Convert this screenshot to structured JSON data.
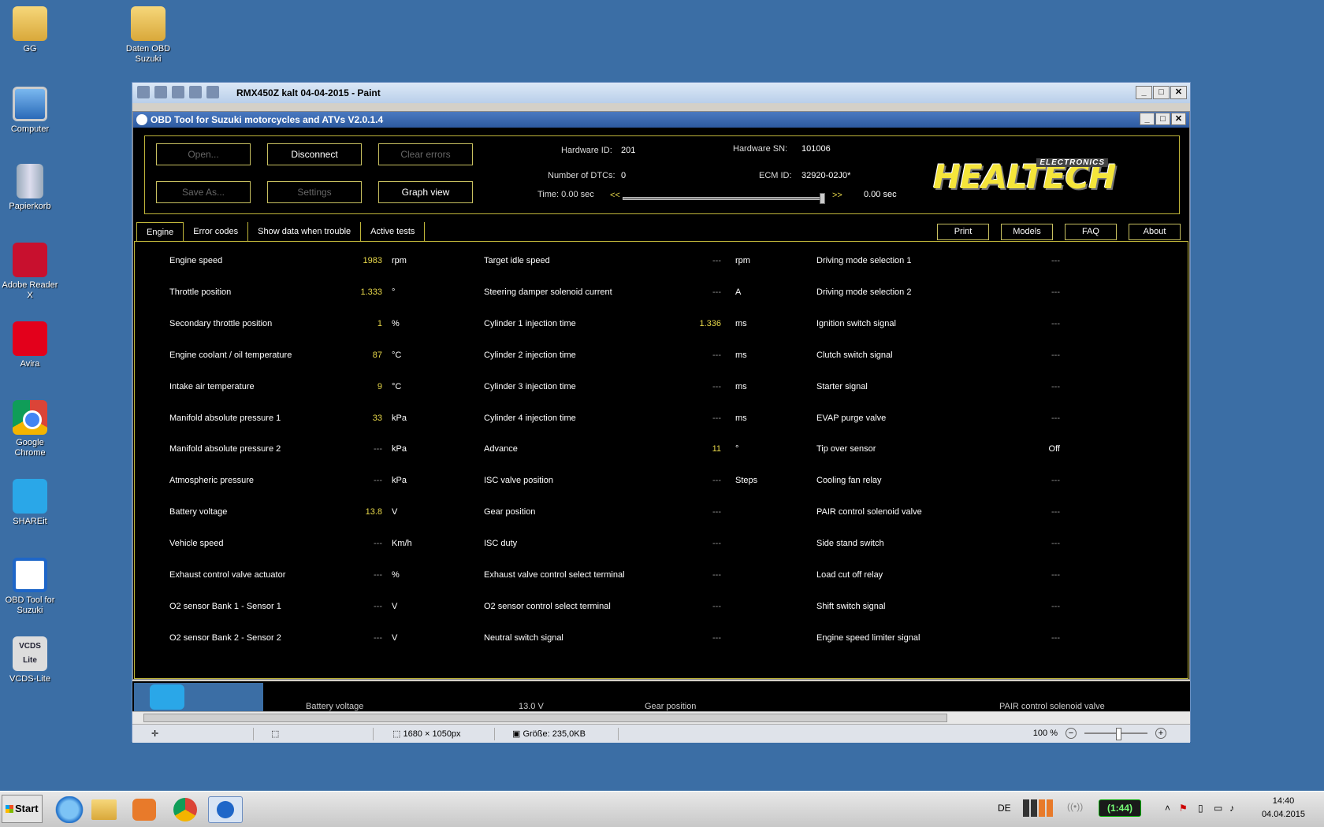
{
  "desktop": {
    "icons": [
      "GG",
      "Daten OBD\nSuzuki",
      "Computer",
      "Papierkorb",
      "Adobe Reader\nX",
      "Avira",
      "Google\nChrome",
      "SHAREit",
      "OBD Tool for\nSuzuki",
      "VCDS-Lite"
    ],
    "vcds_icon_text": "VCDS\nLite"
  },
  "paint": {
    "title": "RMX450Z kalt 04-04-2015 - Paint",
    "status": {
      "dimensions": "1680 × 1050px",
      "size": "Größe: 235,0KB",
      "zoom": "100 %"
    },
    "ghost_texts": [
      "Battery voltage",
      "13.0   V",
      "Gear position",
      "PAIR control solenoid valve"
    ]
  },
  "obd": {
    "title": "OBD Tool for Suzuki motorcycles and ATVs V2.0.1.4",
    "buttons": {
      "open": "Open...",
      "disconnect": "Disconnect",
      "clear": "Clear errors",
      "saveas": "Save As...",
      "settings": "Settings",
      "graph": "Graph view"
    },
    "hardware": {
      "hwid_label": "Hardware ID:",
      "hwid": "201",
      "sn_label": "Hardware SN:",
      "sn": "101006",
      "dtc_label": "Number of DTCs:",
      "dtc": "0",
      "ecm_label": "ECM ID:",
      "ecm": "32920-02J0*",
      "time_label": "Time: 0.00 sec",
      "time_end": "0.00 sec",
      "rew": "<<",
      "fwd": ">>"
    },
    "logo": {
      "main": "HEALTECH",
      "sub": "ELECTRONICS"
    },
    "tabs": [
      "Engine",
      "Error codes",
      "Show data when trouble",
      "Active tests"
    ],
    "right_buttons": [
      "Print",
      "Models",
      "FAQ",
      "About"
    ],
    "col1": [
      {
        "label": "Engine speed",
        "value": "1983",
        "unit": "rpm"
      },
      {
        "label": "Throttle position",
        "value": "1.333",
        "unit": "°"
      },
      {
        "label": "Secondary throttle position",
        "value": "1",
        "unit": "%"
      },
      {
        "label": "Engine coolant / oil temperature",
        "value": "87",
        "unit": "°C"
      },
      {
        "label": "Intake air temperature",
        "value": "9",
        "unit": "°C"
      },
      {
        "label": "Manifold absolute pressure 1",
        "value": "33",
        "unit": "kPa"
      },
      {
        "label": "Manifold absolute pressure 2",
        "value": "---",
        "unit": "kPa"
      },
      {
        "label": "Atmospheric pressure",
        "value": "---",
        "unit": "kPa"
      },
      {
        "label": "Battery voltage",
        "value": "13.8",
        "unit": "V"
      },
      {
        "label": "Vehicle speed",
        "value": "---",
        "unit": "Km/h"
      },
      {
        "label": "Exhaust control valve actuator",
        "value": "---",
        "unit": "%"
      },
      {
        "label": "O2 sensor Bank 1 - Sensor 1",
        "value": "---",
        "unit": "V"
      },
      {
        "label": "O2 sensor Bank 2 - Sensor 2",
        "value": "---",
        "unit": "V"
      }
    ],
    "col2": [
      {
        "label": "Target idle speed",
        "value": "---",
        "unit": "rpm"
      },
      {
        "label": "Steering damper solenoid current",
        "value": "---",
        "unit": "A"
      },
      {
        "label": "Cylinder 1 injection time",
        "value": "1.336",
        "unit": "ms"
      },
      {
        "label": "Cylinder 2 injection time",
        "value": "---",
        "unit": "ms"
      },
      {
        "label": "Cylinder 3 injection time",
        "value": "---",
        "unit": "ms"
      },
      {
        "label": "Cylinder 4 injection time",
        "value": "---",
        "unit": "ms"
      },
      {
        "label": "Advance",
        "value": "11",
        "unit": "°"
      },
      {
        "label": "ISC valve position",
        "value": "---",
        "unit": "Steps"
      },
      {
        "label": "Gear position",
        "value": "---",
        "unit": ""
      },
      {
        "label": "ISC duty",
        "value": "---",
        "unit": ""
      },
      {
        "label": "Exhaust valve control select terminal",
        "value": "---",
        "unit": ""
      },
      {
        "label": "O2 sensor control select terminal",
        "value": "---",
        "unit": ""
      },
      {
        "label": "Neutral switch signal",
        "value": "---",
        "unit": ""
      }
    ],
    "col3": [
      {
        "label": "Driving mode selection 1",
        "value": "---"
      },
      {
        "label": "Driving mode selection 2",
        "value": "---"
      },
      {
        "label": "Ignition switch signal",
        "value": "---"
      },
      {
        "label": "Clutch switch signal",
        "value": "---"
      },
      {
        "label": "Starter signal",
        "value": "---"
      },
      {
        "label": "EVAP purge valve",
        "value": "---"
      },
      {
        "label": "Tip over sensor",
        "value": "Off"
      },
      {
        "label": "Cooling fan relay",
        "value": "---"
      },
      {
        "label": "PAIR control solenoid valve",
        "value": "---"
      },
      {
        "label": "Side stand switch",
        "value": "---"
      },
      {
        "label": "Load cut off relay",
        "value": "---"
      },
      {
        "label": "Shift switch signal",
        "value": "---"
      },
      {
        "label": "Engine speed limiter signal",
        "value": "---"
      }
    ]
  },
  "taskbar": {
    "start": "Start",
    "lang": "DE",
    "battery": "(1:44)",
    "time": "14:40",
    "date": "04.04.2015"
  },
  "colors": {
    "desktop": "#3b6ea5",
    "accent": "#e8d84a",
    "border": "#bfb53a"
  }
}
